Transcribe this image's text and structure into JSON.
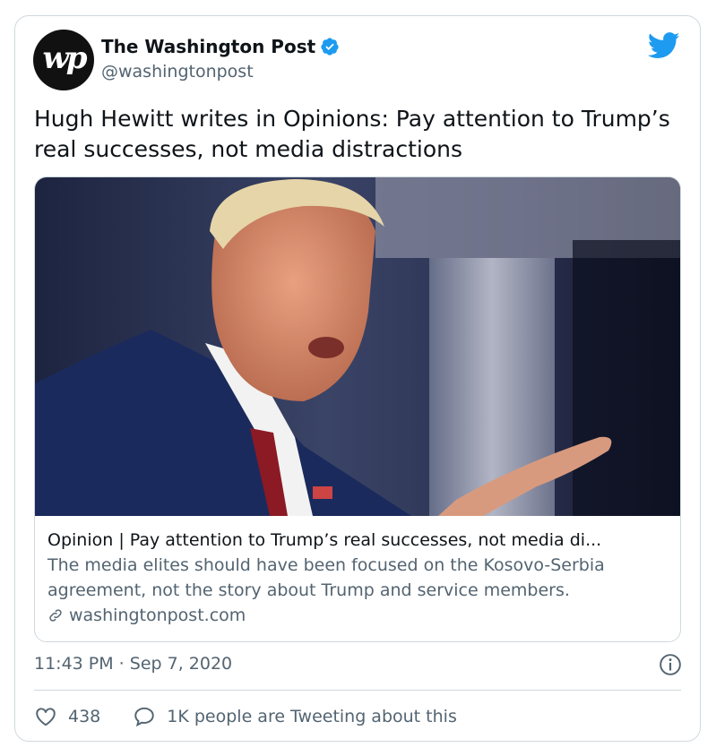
{
  "tweet": {
    "author": {
      "avatar_text": "wp",
      "name": "The Washington Post",
      "handle": "@washingtonpost",
      "verified": true
    },
    "text": "Hugh Hewitt writes in Opinions: Pay attention to Trump’s real successes, not media distractions",
    "link_card": {
      "title": "Opinion | Pay attention to Trump’s real successes, not media di...",
      "description": "The media elites should have been focused on the Kosovo-Serbia agreement, not the story about Trump and service members.",
      "domain": "washingtonpost.com"
    },
    "timestamp": "11:43 PM · Sep 7, 2020",
    "likes": "438",
    "conversation_text": "1K people are Tweeting about this"
  },
  "colors": {
    "twitter_blue": "#1d9bf0",
    "secondary_text": "#536471",
    "border": "#cfd9de"
  },
  "icons": [
    "verified-badge-icon",
    "twitter-bird-icon",
    "link-icon",
    "info-icon",
    "heart-icon",
    "reply-bubble-icon"
  ]
}
